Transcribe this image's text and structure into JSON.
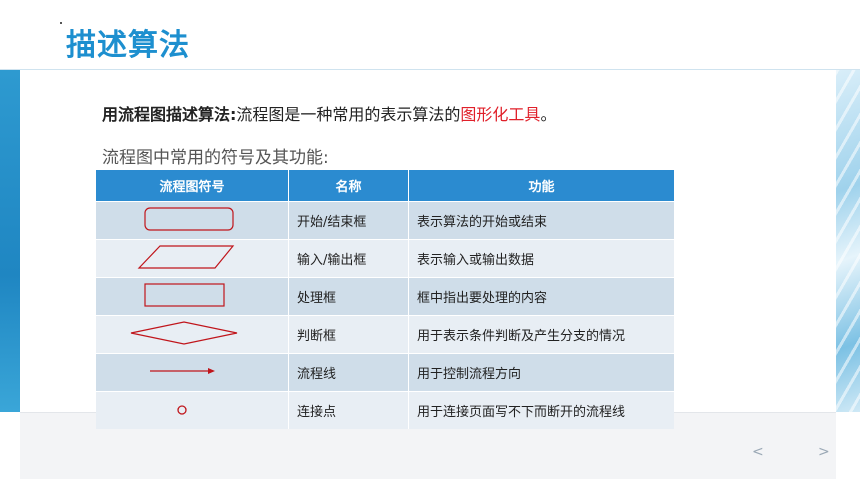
{
  "page": {
    "title": "描述算法",
    "intro": {
      "bold": "用流程图描述算法:",
      "normal": "流程图是一种常用的表示算法的",
      "highlight": "图形化工具",
      "end": "。"
    },
    "subtitle": "流程图中常用的符号及其功能:"
  },
  "table": {
    "headers": [
      "流程图符号",
      "名称",
      "功能"
    ],
    "rows": [
      {
        "symbol": "rounded-rectangle",
        "name": "开始/结束框",
        "function": "表示算法的开始或结束"
      },
      {
        "symbol": "parallelogram",
        "name": "输入/输出框",
        "function": "表示输入或输出数据"
      },
      {
        "symbol": "rectangle",
        "name": "处理框",
        "function": "框中指出要处理的内容"
      },
      {
        "symbol": "diamond",
        "name": "判断框",
        "function": "用于表示条件判断及产生分支的情况"
      },
      {
        "symbol": "arrow",
        "name": "流程线",
        "function": "用于控制流程方向"
      },
      {
        "symbol": "small-circle",
        "name": "连接点",
        "function": "用于连接页面写不下而断开的流程线"
      }
    ]
  },
  "nav": {
    "prev": "<",
    "next": ">"
  },
  "colors": {
    "accent": "#1d8fcf",
    "header_bg": "#2b8bd0",
    "symbol_stroke": "#c0151b",
    "highlight": "#e0202a"
  }
}
